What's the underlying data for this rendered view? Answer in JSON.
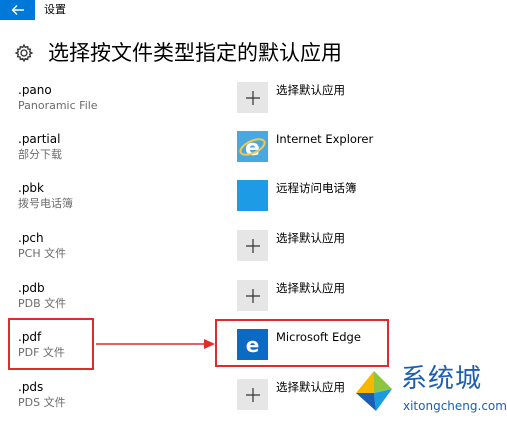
{
  "window": {
    "title": "设置",
    "back_icon": "back-arrow-icon",
    "accent_color": "#0078d7"
  },
  "page": {
    "title": "选择按文件类型指定的默认应用",
    "icon": "gear-icon"
  },
  "rows": [
    {
      "ext": ".pano",
      "desc": "Panoramic File",
      "app": "选择默认应用",
      "icon": "plus-icon"
    },
    {
      "ext": ".partial",
      "desc": "部分下载",
      "app": "Internet Explorer",
      "icon": "internet-explorer-icon"
    },
    {
      "ext": ".pbk",
      "desc": "拨号电话簿",
      "app": "远程访问电话簿",
      "icon": "remote-access-phonebook-icon"
    },
    {
      "ext": ".pch",
      "desc": "PCH 文件",
      "app": "选择默认应用",
      "icon": "plus-icon"
    },
    {
      "ext": ".pdb",
      "desc": "PDB 文件",
      "app": "选择默认应用",
      "icon": "plus-icon"
    },
    {
      "ext": ".pdf",
      "desc": "PDF 文件",
      "app": "Microsoft Edge",
      "icon": "microsoft-edge-icon"
    },
    {
      "ext": ".pds",
      "desc": "PDS 文件",
      "app": "选择默认应用",
      "icon": "plus-icon"
    }
  ],
  "annotation": {
    "color": "#e12b2b"
  },
  "watermark": {
    "text": "系统城",
    "url": "xitongcheng.com",
    "color": "#1a5fb4"
  }
}
